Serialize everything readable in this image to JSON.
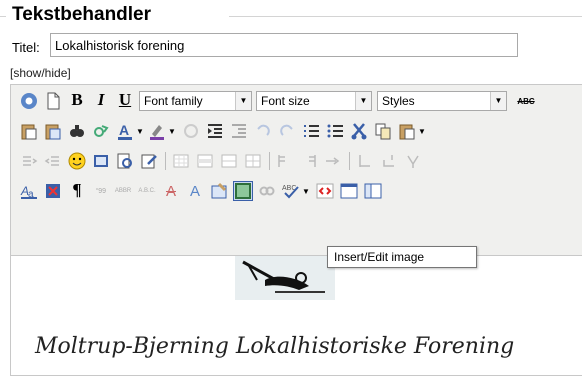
{
  "section": {
    "legend": "Tekstbehandler"
  },
  "title_field": {
    "label": "Titel:",
    "value": "Lokalhistorisk forening"
  },
  "toggle": {
    "label": "[show/hide]"
  },
  "toolbar": {
    "bold_label": "B",
    "italic_label": "I",
    "underline_label": "U",
    "font_family": "Font family",
    "font_size": "Font size",
    "styles": "Styles",
    "spell_label": "ABC"
  },
  "tooltip": {
    "text": "Insert/Edit image"
  },
  "document": {
    "heading": "Moltrup-Bjerning Lokalhistoriske Forening"
  },
  "colors": {
    "accent_blue": "#3a5fa8",
    "red_underline": "#d11",
    "toolbar_bg": "#f0f0ee"
  }
}
